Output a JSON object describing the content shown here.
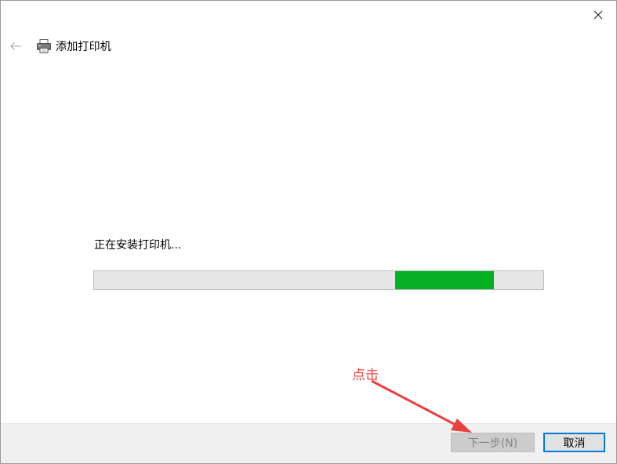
{
  "window": {
    "title": "添加打印机",
    "close_icon": "close-icon",
    "back_icon": "back-arrow-icon",
    "title_icon": "printer-icon"
  },
  "content": {
    "status_text": "正在安装打印机...",
    "progress": {
      "mode": "indeterminate-marquee",
      "chunk_start_fraction": 0.67,
      "chunk_end_fraction": 0.89,
      "fill_color": "#06b025",
      "track_color": "#e6e6e6"
    }
  },
  "footer": {
    "next_label": "下一步(N)",
    "next_enabled": false,
    "cancel_label": "取消"
  },
  "annotation": {
    "label": "点击",
    "color": "#e8413e",
    "arrow_icon": "red-arrow-icon"
  }
}
